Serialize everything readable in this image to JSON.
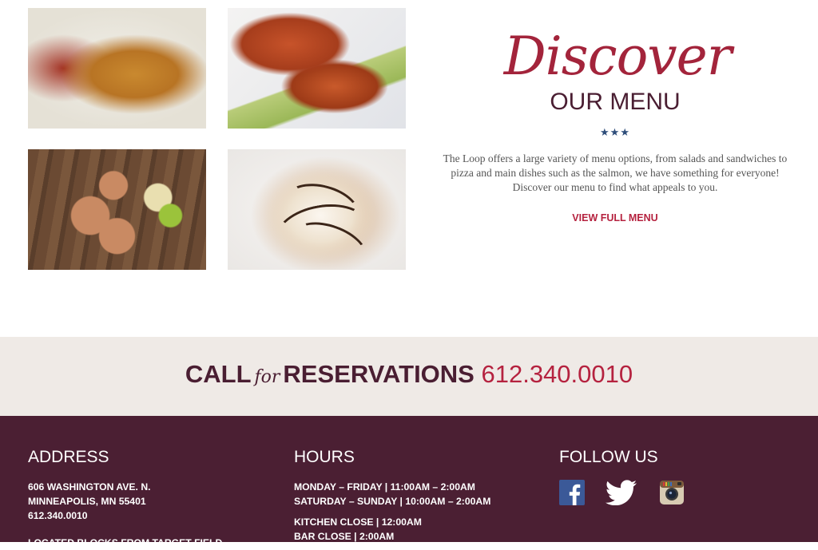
{
  "menu_section": {
    "title_script": "Discover",
    "title": "OUR MENU",
    "stars": "★★★",
    "description": "The Loop offers a large variety of menu options, from salads and sandwiches to pizza and main dishes such as the salmon, we have something for everyone! Discover our menu to find what appeals to you.",
    "cta_label": "VIEW FULL MENU"
  },
  "reservations": {
    "call": "CALL",
    "for": "for",
    "reservations": "RESERVATIONS",
    "phone": "612.340.0010"
  },
  "footer": {
    "address": {
      "heading": "ADDRESS",
      "line1": "606 WASHINGTON AVE. N.",
      "line2": "MINNEAPOLIS, MN 55401",
      "phone": "612.340.0010",
      "note": "LOCATED BLOCKS FROM TARGET FIELD"
    },
    "hours": {
      "heading": "HOURS",
      "weekday": "MONDAY – FRIDAY  |  11:00AM – 2:00AM",
      "weekend": "SATURDAY – SUNDAY  |  10:00AM – 2:00AM",
      "kitchen": "KITCHEN CLOSE  |  12:00AM",
      "bar": "BAR CLOSE  |  2:00AM"
    },
    "follow": {
      "heading": "FOLLOW US",
      "icons": [
        "facebook-icon",
        "twitter-icon",
        "instagram-icon"
      ]
    }
  },
  "colors": {
    "brand_red": "#b5223f",
    "maroon": "#4b1f33",
    "band": "#efeae6",
    "facebook": "#3b5998"
  }
}
